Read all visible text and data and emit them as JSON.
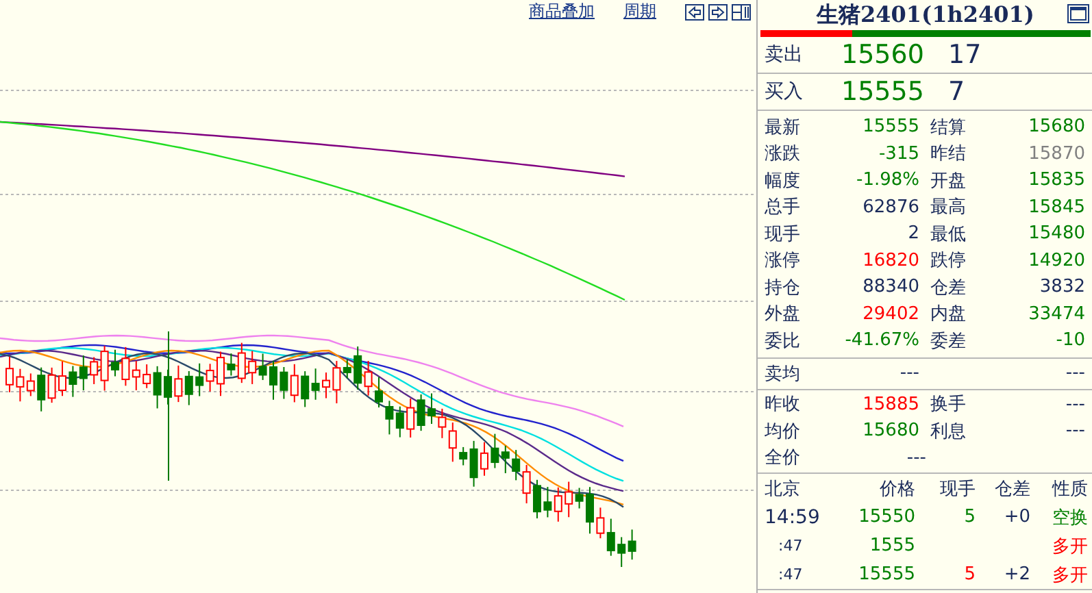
{
  "toolbar": {
    "links": [
      {
        "label": "商品叠加"
      },
      {
        "label": "周期"
      }
    ]
  },
  "quote": {
    "title": "生猪2401(1h2401)",
    "ratio_bar": {
      "level": 0.28
    },
    "ask": {
      "label": "卖出",
      "price": "15560",
      "volume": "17"
    },
    "bid": {
      "label": "买入",
      "price": "15555",
      "volume": "7"
    },
    "stats": [
      {
        "left": {
          "label": "最新",
          "value": "15555",
          "color": "#008000"
        },
        "right": {
          "label": "结算",
          "value": "15680",
          "color": "#008000"
        }
      },
      {
        "left": {
          "label": "涨跌",
          "value": "-315",
          "color": "#008000"
        },
        "right": {
          "label": "昨结",
          "value": "15870",
          "color": "#808080"
        }
      },
      {
        "left": {
          "label": "幅度",
          "value": "-1.98%",
          "color": "#008000"
        },
        "right": {
          "label": "开盘",
          "value": "15835",
          "color": "#008000"
        }
      },
      {
        "left": {
          "label": "总手",
          "value": "62876",
          "color": "#1a2a5a"
        },
        "right": {
          "label": "最高",
          "value": "15845",
          "color": "#008000"
        }
      },
      {
        "left": {
          "label": "现手",
          "value": "2",
          "color": "#1a2a5a"
        },
        "right": {
          "label": "最低",
          "value": "15480",
          "color": "#008000"
        }
      },
      {
        "left": {
          "label": "涨停",
          "value": "16820",
          "color": "#ff0000"
        },
        "right": {
          "label": "跌停",
          "value": "14920",
          "color": "#008000"
        }
      },
      {
        "left": {
          "label": "持仓",
          "value": "88340",
          "color": "#1a2a5a"
        },
        "right": {
          "label": "仓差",
          "value": "3832",
          "color": "#1a2a5a"
        }
      },
      {
        "left": {
          "label": "外盘",
          "value": "29402",
          "color": "#ff0000"
        },
        "right": {
          "label": "内盘",
          "value": "33474",
          "color": "#008000"
        }
      },
      {
        "left": {
          "label": "委比",
          "value": "-41.67%",
          "color": "#008000"
        },
        "right": {
          "label": "委差",
          "value": "-10",
          "color": "#008000"
        }
      }
    ],
    "avg_sell": {
      "label": "卖均",
      "value": "---",
      "value_2": "---"
    },
    "extra": [
      {
        "left": {
          "label": "昨收",
          "value": "15885",
          "color": "#ff0000"
        },
        "right": {
          "label": "换手",
          "value": "---",
          "color": "#1a2a5a"
        }
      },
      {
        "left": {
          "label": "均价",
          "value": "15680",
          "color": "#008000"
        },
        "right": {
          "label": "利息",
          "value": "---",
          "color": "#1a2a5a"
        }
      },
      {
        "left": {
          "label": "全价",
          "value": "---",
          "color": "#1a2a5a"
        }
      }
    ]
  },
  "trades": {
    "columns": [
      "北京",
      "价格",
      "现手",
      "仓差",
      "性质"
    ],
    "rows": [
      {
        "time": "14:59",
        "price": "15550",
        "hand": "5",
        "diff": "+0",
        "nature": "空换",
        "color": "#008000"
      },
      {
        "time": ":47",
        "price": "1555",
        "nature": "多开",
        "color": "#ff0000"
      },
      {
        "time": ":47",
        "price": "15555",
        "hand": "5",
        "diff": "+2",
        "nature": "多开",
        "color": "#ff0000"
      }
    ]
  }
}
